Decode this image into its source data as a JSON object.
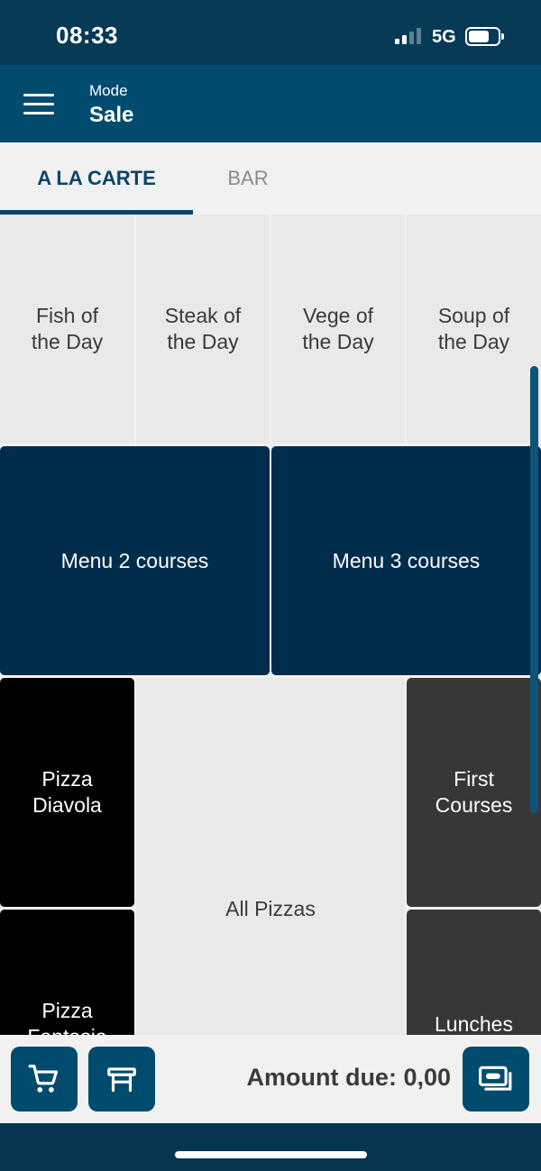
{
  "status": {
    "time": "08:33",
    "network": "5G",
    "battery_level": 0.7
  },
  "header": {
    "mode_label": "Mode",
    "mode_value": "Sale"
  },
  "tabs": [
    {
      "label": "A LA CARTE",
      "active": true
    },
    {
      "label": "BAR",
      "active": false
    }
  ],
  "tiles": {
    "fish": "Fish of the Day",
    "steak": "Steak of the Day",
    "vege": "Vege of the Day",
    "soup": "Soup of the Day",
    "menu2": "Menu 2 courses",
    "menu3": "Menu 3 courses",
    "pizza_diavola": "Pizza Diavola",
    "all_pizzas": "All Pizzas",
    "first_courses": "First Courses",
    "pizza_fantasia": "Pizza Fantasia",
    "lunches": "Lunches"
  },
  "footer": {
    "amount_due": "Amount due: 0,00"
  },
  "icons": {
    "cart": "cart-icon",
    "table": "table-icon",
    "payment": "cash-icon",
    "menu": "hamburger-icon"
  },
  "colors": {
    "primary": "#004b6e",
    "tile_navy": "#002d4b",
    "tile_gray": "#373737",
    "tile_black": "#000000"
  }
}
